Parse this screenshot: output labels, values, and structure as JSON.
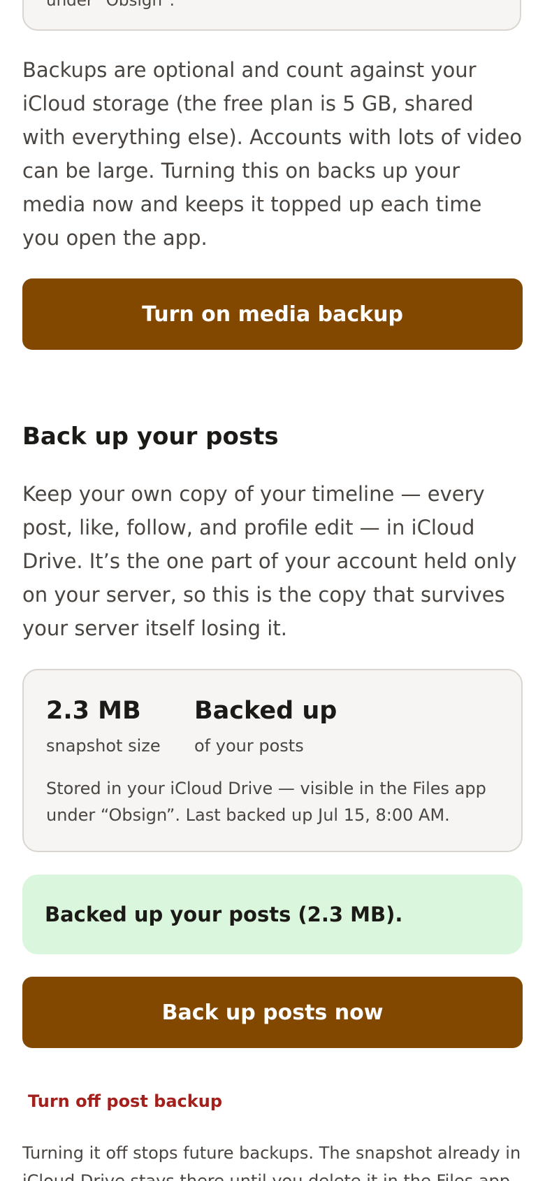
{
  "top_card": {
    "text": "under “Obsign”."
  },
  "media_backup": {
    "description": "Backups are optional and count against your iCloud storage (the free plan is 5 GB, shared with everything else). Accounts with lots of video can be large. Turning this on backs up your media now and keeps it topped up each time you open the app.",
    "button_label": "Turn on media backup"
  },
  "post_backup": {
    "heading": "Back up your posts",
    "description": "Keep your own copy of your timeline — every post, like, follow, and profile edit — in iCloud Drive. It’s the one part of your account held only on your server, so this is the copy that survives your server itself losing it.",
    "stats": {
      "size_value": "2.3 MB",
      "size_label": "snapshot size",
      "status_value": "Backed up",
      "status_label": "of your posts",
      "note": "Stored in your iCloud Drive — visible in the Files app under “Obsign”. Last backed up Jul 15, 8:00 AM."
    },
    "success_message": "Backed up your posts (2.3 MB).",
    "button_label": "Back up posts now",
    "turn_off_label": "Turn off post backup",
    "footer": "Turning it off stops future backups. The snapshot already in iCloud Drive stays there until you delete it in the Files app."
  },
  "colors": {
    "primary": "#824800",
    "success_bg": "#daf6dd",
    "danger": "#a3201c",
    "card_bg": "#f6f5f3",
    "card_border": "#d9d6d1"
  }
}
